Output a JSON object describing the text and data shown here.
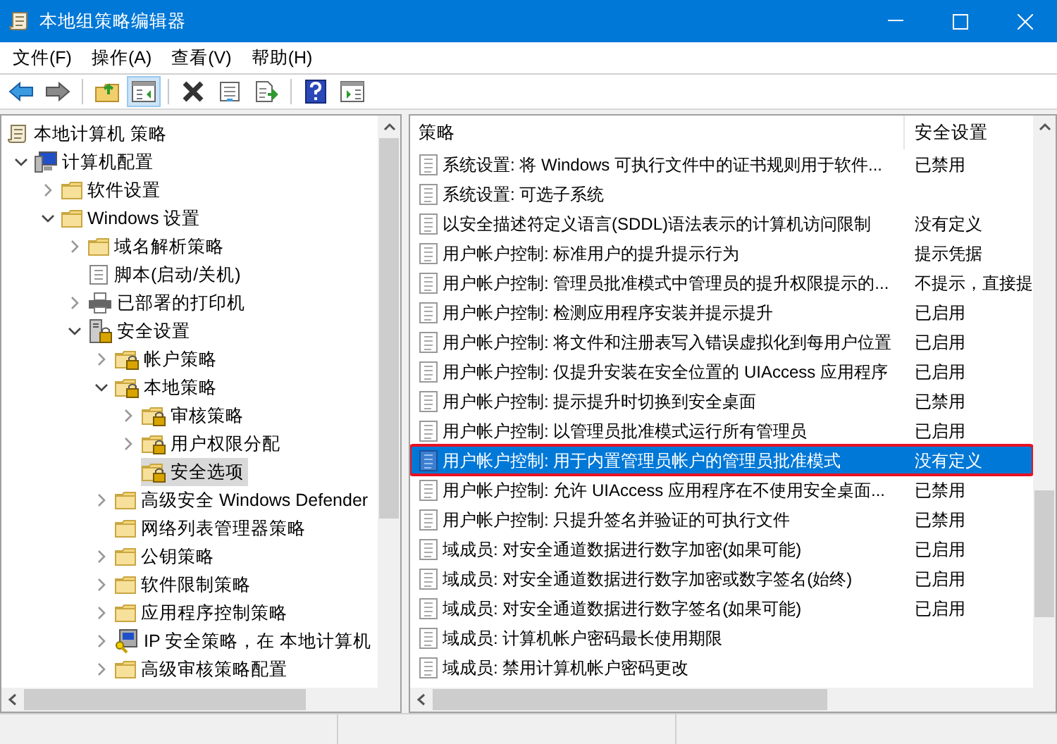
{
  "window": {
    "title": "本地组策略编辑器"
  },
  "menu": [
    "文件(F)",
    "操作(A)",
    "查看(V)",
    "帮助(H)"
  ],
  "toolbar": [
    {
      "kind": "back",
      "pressed": false
    },
    {
      "kind": "forward",
      "pressed": false
    },
    {
      "kind": "sep"
    },
    {
      "kind": "up",
      "pressed": false
    },
    {
      "kind": "tree",
      "pressed": true
    },
    {
      "kind": "sep"
    },
    {
      "kind": "delete",
      "pressed": false
    },
    {
      "kind": "properties",
      "pressed": false
    },
    {
      "kind": "export",
      "pressed": false
    },
    {
      "kind": "sep"
    },
    {
      "kind": "help",
      "pressed": false
    },
    {
      "kind": "actionpane",
      "pressed": false
    }
  ],
  "tree": [
    {
      "label": "本地计算机 策略",
      "kind": "policy",
      "selected": false,
      "children": [
        {
          "label": "计算机配置",
          "kind": "computer",
          "expanded": true,
          "selected": false,
          "children": [
            {
              "label": "软件设置",
              "kind": "folder",
              "expanded": false,
              "selected": false
            },
            {
              "label": "Windows 设置",
              "kind": "folder",
              "expanded": true,
              "selected": false,
              "children": [
                {
                  "label": "域名解析策略",
                  "kind": "folder",
                  "expanded": false,
                  "selected": false
                },
                {
                  "label": "脚本(启动/关机)",
                  "kind": "script",
                  "selected": false
                },
                {
                  "label": "已部署的打印机",
                  "kind": "printer",
                  "expanded": false,
                  "selected": false
                },
                {
                  "label": "安全设置",
                  "kind": "security",
                  "expanded": true,
                  "selected": false,
                  "children": [
                    {
                      "label": "帐户策略",
                      "kind": "lockfolder",
                      "expanded": false,
                      "selected": false
                    },
                    {
                      "label": "本地策略",
                      "kind": "lockfolder",
                      "expanded": true,
                      "selected": false,
                      "children": [
                        {
                          "label": "审核策略",
                          "kind": "lockfolder",
                          "expanded": false,
                          "selected": false
                        },
                        {
                          "label": "用户权限分配",
                          "kind": "lockfolder",
                          "expanded": false,
                          "selected": false
                        },
                        {
                          "label": "安全选项",
                          "kind": "lockfolder",
                          "selected": true
                        }
                      ]
                    },
                    {
                      "label": "高级安全 Windows Defender",
                      "kind": "folder",
                      "expanded": false,
                      "selected": false
                    },
                    {
                      "label": "网络列表管理器策略",
                      "kind": "folder",
                      "selected": false
                    },
                    {
                      "label": "公钥策略",
                      "kind": "folder",
                      "expanded": false,
                      "selected": false
                    },
                    {
                      "label": "软件限制策略",
                      "kind": "folder",
                      "expanded": false,
                      "selected": false
                    },
                    {
                      "label": "应用程序控制策略",
                      "kind": "folder",
                      "expanded": false,
                      "selected": false
                    },
                    {
                      "label": "IP 安全策略，在 本地计算机",
                      "kind": "ipsec",
                      "expanded": false,
                      "selected": false
                    },
                    {
                      "label": "高级审核策略配置",
                      "kind": "folder",
                      "expanded": false,
                      "selected": false
                    }
                  ]
                }
              ]
            }
          ]
        }
      ]
    }
  ],
  "table": {
    "columns": [
      "策略",
      "安全设置"
    ],
    "outline_selected": true,
    "rows": [
      {
        "policy": "系统设置: 将 Windows 可执行文件中的证书规则用于软件...",
        "setting": "已禁用",
        "selected": false
      },
      {
        "policy": "系统设置: 可选子系统",
        "selected": false
      },
      {
        "policy": "以安全描述符定义语言(SDDL)语法表示的计算机访问限制",
        "setting": "没有定义",
        "selected": false
      },
      {
        "policy": "用户帐户控制: 标准用户的提升提示行为",
        "setting": "提示凭据",
        "selected": false
      },
      {
        "policy": "用户帐户控制: 管理员批准模式中管理员的提升权限提示的...",
        "setting": "不提示，直接提",
        "selected": false
      },
      {
        "policy": "用户帐户控制: 检测应用程序安装并提示提升",
        "setting": "已启用",
        "selected": false
      },
      {
        "policy": "用户帐户控制: 将文件和注册表写入错误虚拟化到每用户位置",
        "setting": "已启用",
        "selected": false
      },
      {
        "policy": "用户帐户控制: 仅提升安装在安全位置的 UIAccess 应用程序",
        "setting": "已启用",
        "selected": false
      },
      {
        "policy": "用户帐户控制: 提示提升时切换到安全桌面",
        "setting": "已禁用",
        "selected": false
      },
      {
        "policy": "用户帐户控制: 以管理员批准模式运行所有管理员",
        "setting": "已启用",
        "selected": false
      },
      {
        "policy": "用户帐户控制: 用于内置管理员帐户的管理员批准模式",
        "setting": "没有定义",
        "selected": true
      },
      {
        "policy": "用户帐户控制: 允许 UIAccess 应用程序在不使用安全桌面...",
        "setting": "已禁用",
        "selected": false
      },
      {
        "policy": "用户帐户控制: 只提升签名并验证的可执行文件",
        "setting": "已禁用",
        "selected": false
      },
      {
        "policy": "域成员: 对安全通道数据进行数字加密(如果可能)",
        "setting": "已启用",
        "selected": false
      },
      {
        "policy": "域成员: 对安全通道数据进行数字加密或数字签名(始终)",
        "setting": "已启用",
        "selected": false
      },
      {
        "policy": "域成员: 对安全通道数据进行数字签名(如果可能)",
        "setting": "已启用",
        "selected": false
      },
      {
        "policy": "域成员: 计算机帐户密码最长使用期限",
        "selected": false
      },
      {
        "policy": "域成员: 禁用计算机帐户密码更改",
        "selected": false
      }
    ]
  }
}
